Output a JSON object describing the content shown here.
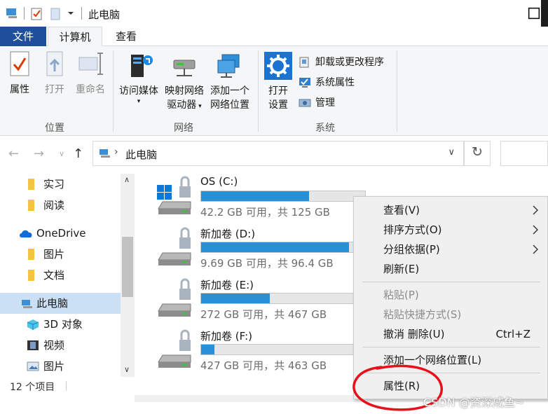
{
  "window": {
    "title": "此电脑"
  },
  "ribbon_tabs": {
    "file": "文件",
    "computer": "计算机",
    "view": "查看"
  },
  "ribbon": {
    "location_group": {
      "label": "位置",
      "properties": "属性",
      "open": "打开",
      "rename": "重命名"
    },
    "network_group": {
      "label": "网络",
      "access_media_1": "访问媒体",
      "map_drive_1": "映射网络",
      "map_drive_2": "驱动器",
      "add_location_1": "添加一个",
      "add_location_2": "网络位置"
    },
    "system_group": {
      "label": "系统",
      "open_settings_1": "打开",
      "open_settings_2": "设置",
      "uninstall": "卸载或更改程序",
      "system_properties": "系统属性",
      "manage": "管理"
    }
  },
  "address": {
    "path": "此电脑"
  },
  "nav": {
    "items": [
      {
        "label": "实习",
        "icon": "folder-icon"
      },
      {
        "label": "阅读",
        "icon": "folder-icon"
      },
      {
        "label": "OneDrive",
        "icon": "cloud-icon"
      },
      {
        "label": "图片",
        "icon": "folder-icon"
      },
      {
        "label": "文档",
        "icon": "folder-icon"
      },
      {
        "label": "此电脑",
        "icon": "computer-icon"
      },
      {
        "label": "3D 对象",
        "icon": "cube-icon"
      },
      {
        "label": "视频",
        "icon": "film-icon"
      },
      {
        "label": "图片",
        "icon": "picture-icon"
      }
    ]
  },
  "drives": [
    {
      "name": "OS (C:)",
      "info": "42.2 GB 可用，共 125 GB",
      "used_fraction": 0.66
    },
    {
      "name": "新加卷 (D:)",
      "info": "9.69 GB 可用，共 96.4 GB",
      "used_fraction": 0.9
    },
    {
      "name": "新加卷 (E:)",
      "info": "272 GB 可用，共 467 GB",
      "used_fraction": 0.42
    },
    {
      "name": "新加卷 (F:)",
      "info": "427 GB 可用，共 463 GB",
      "used_fraction": 0.08
    }
  ],
  "status": {
    "item_count": "12 个项目"
  },
  "context_menu": {
    "view": "查看(V)",
    "sort": "排序方式(O)",
    "group": "分组依据(P)",
    "refresh": "刷新(E)",
    "paste": "粘贴(P)",
    "paste_shortcut": "粘贴快捷方式(S)",
    "undo": "撤消 删除(U)",
    "undo_shortcut": "Ctrl+Z",
    "add_network_location": "添加一个网络位置(L)",
    "properties": "属性(R)"
  },
  "watermark": "CSDN @资深咸鱼~",
  "colors": {
    "accent": "#1f4e9c",
    "drive_bar": "#2691d9",
    "annotation": "#e8101a"
  }
}
